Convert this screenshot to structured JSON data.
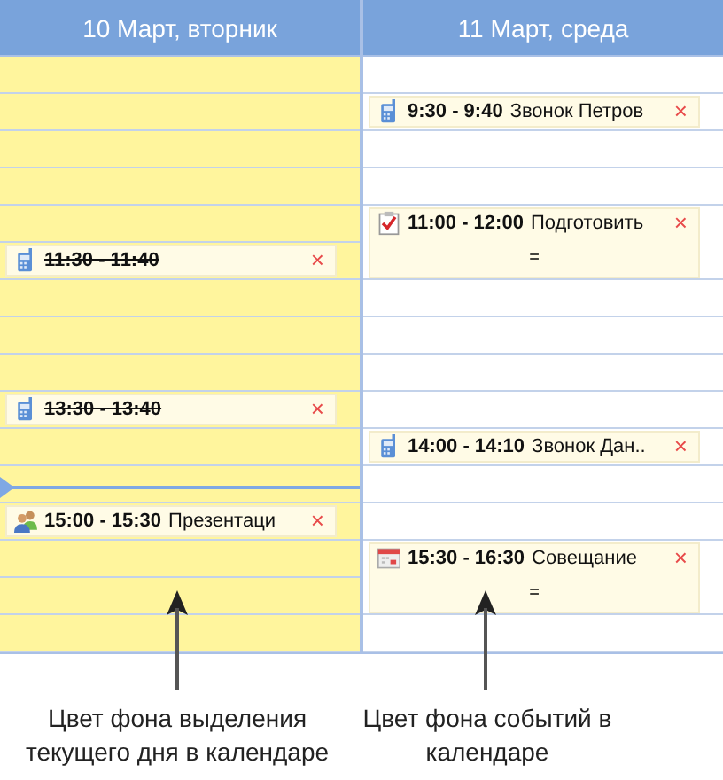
{
  "days": [
    {
      "title": "10 Март, вторник",
      "selected": true,
      "rows": [
        {
          "kind": "empty"
        },
        {
          "kind": "empty"
        },
        {
          "kind": "empty"
        },
        {
          "kind": "empty"
        },
        {
          "kind": "empty"
        },
        {
          "kind": "event",
          "event": {
            "kind": "phone",
            "time": "11:30 - 11:40",
            "done": true,
            "close": "×",
            "tall": false
          }
        },
        {
          "kind": "empty"
        },
        {
          "kind": "empty"
        },
        {
          "kind": "empty"
        },
        {
          "kind": "event",
          "event": {
            "kind": "phone",
            "time": "13:30 - 13:40",
            "done": true,
            "close": "×",
            "tall": false
          }
        },
        {
          "kind": "empty"
        },
        {
          "kind": "now"
        },
        {
          "kind": "event",
          "event": {
            "kind": "people",
            "time": "15:00 - 15:30",
            "title": "Презентаци",
            "done": false,
            "close": "×",
            "tall": false
          }
        },
        {
          "kind": "empty"
        },
        {
          "kind": "empty"
        },
        {
          "kind": "empty"
        }
      ]
    },
    {
      "title": "11 Март, среда",
      "selected": false,
      "rows": [
        {
          "kind": "empty"
        },
        {
          "kind": "event",
          "event": {
            "kind": "phone",
            "time": "9:30 - 9:40",
            "title": "Звонок Петров",
            "done": false,
            "close": "×",
            "tall": false
          }
        },
        {
          "kind": "empty"
        },
        {
          "kind": "empty"
        },
        {
          "kind": "event",
          "event": {
            "kind": "task",
            "time": "11:00 - 12:00",
            "title": "Подготовить",
            "done": false,
            "close": "×",
            "tall": true,
            "handle": "="
          }
        },
        {
          "kind": "empty"
        },
        {
          "kind": "empty"
        },
        {
          "kind": "empty"
        },
        {
          "kind": "empty"
        },
        {
          "kind": "event",
          "event": {
            "kind": "phone",
            "time": "14:00 - 14:10",
            "title": "Звонок Дан..",
            "done": false,
            "close": "×",
            "tall": false
          }
        },
        {
          "kind": "empty"
        },
        {
          "kind": "empty"
        },
        {
          "kind": "event",
          "event": {
            "kind": "meeting",
            "time": "15:30 - 16:30",
            "title": "Совещание",
            "done": false,
            "close": "×",
            "tall": true,
            "handle": "="
          }
        },
        {
          "kind": "empty"
        }
      ]
    }
  ],
  "callouts": [
    "Цвет фона выделения текущего дня в календаре",
    "Цвет фона событий в календаре"
  ]
}
